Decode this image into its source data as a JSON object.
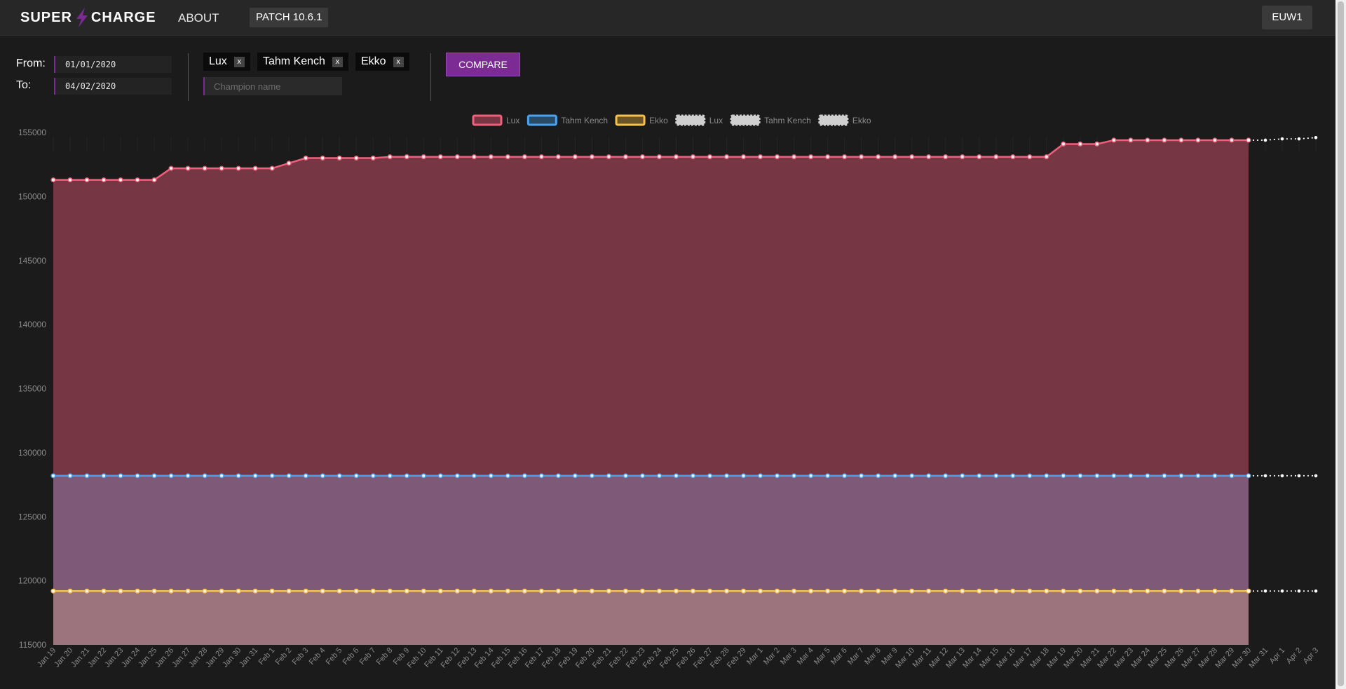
{
  "header": {
    "logo_left": "SUPER",
    "logo_right": "CHARGE",
    "about_label": "ABOUT",
    "patch_label": "PATCH 10.6.1",
    "region_label": "EUW1"
  },
  "colors": {
    "accent": "#7b2b93",
    "lux": "#f0607c",
    "tahm": "#4aa3f0",
    "ekko": "#f5c24e"
  },
  "icons": {
    "logo": "lightning-bolt-icon",
    "remove_champion": "close-x-icon"
  },
  "filters": {
    "from_label": "From:",
    "to_label": "To:",
    "from_value": "01/01/2020",
    "to_value": "04/02/2020",
    "champions": [
      {
        "name": "Lux",
        "remove": "x"
      },
      {
        "name": "Tahm Kench",
        "remove": "x"
      },
      {
        "name": "Ekko",
        "remove": "x"
      }
    ],
    "search_placeholder": "Champion name",
    "compare_label": "COMPARE"
  },
  "chart_data": {
    "type": "area",
    "x": [
      "Jan 19",
      "Jan 20",
      "Jan 21",
      "Jan 22",
      "Jan 23",
      "Jan 24",
      "Jan 25",
      "Jan 26",
      "Jan 27",
      "Jan 28",
      "Jan 29",
      "Jan 30",
      "Jan 31",
      "Feb 1",
      "Feb 2",
      "Feb 3",
      "Feb 4",
      "Feb 5",
      "Feb 6",
      "Feb 7",
      "Feb 8",
      "Feb 9",
      "Feb 10",
      "Feb 11",
      "Feb 12",
      "Feb 13",
      "Feb 14",
      "Feb 15",
      "Feb 16",
      "Feb 17",
      "Feb 18",
      "Feb 19",
      "Feb 20",
      "Feb 21",
      "Feb 22",
      "Feb 23",
      "Feb 24",
      "Feb 25",
      "Feb 26",
      "Feb 27",
      "Feb 28",
      "Feb 29",
      "Mar 1",
      "Mar 2",
      "Mar 3",
      "Mar 4",
      "Mar 5",
      "Mar 6",
      "Mar 7",
      "Mar 8",
      "Mar 9",
      "Mar 10",
      "Mar 11",
      "Mar 12",
      "Mar 13",
      "Mar 14",
      "Mar 15",
      "Mar 16",
      "Mar 17",
      "Mar 18",
      "Mar 19",
      "Mar 20",
      "Mar 21",
      "Mar 22",
      "Mar 23",
      "Mar 24",
      "Mar 25",
      "Mar 26",
      "Mar 27",
      "Mar 28",
      "Mar 29",
      "Mar 30",
      "Mar 31",
      "Apr 1",
      "Apr 2",
      "Apr 3"
    ],
    "ylim": [
      115000,
      155000
    ],
    "yticks": [
      155000,
      150000,
      145000,
      140000,
      135000,
      130000,
      125000,
      120000,
      115000
    ],
    "legend_position": "top-center",
    "grid": false,
    "series": [
      {
        "name": "Lux",
        "values": [
          151300,
          151300,
          151300,
          151300,
          151300,
          151300,
          151300,
          152200,
          152200,
          152200,
          152200,
          152200,
          152200,
          152200,
          152600,
          153000,
          153000,
          153000,
          153000,
          153000,
          153100,
          153100,
          153100,
          153100,
          153100,
          153100,
          153100,
          153100,
          153100,
          153100,
          153100,
          153100,
          153100,
          153100,
          153100,
          153100,
          153100,
          153100,
          153100,
          153100,
          153100,
          153100,
          153100,
          153100,
          153100,
          153100,
          153100,
          153100,
          153100,
          153100,
          153100,
          153100,
          153100,
          153100,
          153100,
          153100,
          153100,
          153100,
          153100,
          153100,
          154100,
          154100,
          154100,
          154400,
          154400,
          154400,
          154400,
          154400,
          154400,
          154400,
          154400,
          154400
        ]
      },
      {
        "name": "Tahm Kench",
        "values": [
          128200,
          128200,
          128200,
          128200,
          128200,
          128200,
          128200,
          128200,
          128200,
          128200,
          128200,
          128200,
          128200,
          128200,
          128200,
          128200,
          128200,
          128200,
          128200,
          128200,
          128200,
          128200,
          128200,
          128200,
          128200,
          128200,
          128200,
          128200,
          128200,
          128200,
          128200,
          128200,
          128200,
          128200,
          128200,
          128200,
          128200,
          128200,
          128200,
          128200,
          128200,
          128200,
          128200,
          128200,
          128200,
          128200,
          128200,
          128200,
          128200,
          128200,
          128200,
          128200,
          128200,
          128200,
          128200,
          128200,
          128200,
          128200,
          128200,
          128200,
          128200,
          128200,
          128200,
          128200,
          128200,
          128200,
          128200,
          128200,
          128200,
          128200,
          128200,
          128200
        ]
      },
      {
        "name": "Ekko",
        "values": [
          119200,
          119200,
          119200,
          119200,
          119200,
          119200,
          119200,
          119200,
          119200,
          119200,
          119200,
          119200,
          119200,
          119200,
          119200,
          119200,
          119200,
          119200,
          119200,
          119200,
          119200,
          119200,
          119200,
          119200,
          119200,
          119200,
          119200,
          119200,
          119200,
          119200,
          119200,
          119200,
          119200,
          119200,
          119200,
          119200,
          119200,
          119200,
          119200,
          119200,
          119200,
          119200,
          119200,
          119200,
          119200,
          119200,
          119200,
          119200,
          119200,
          119200,
          119200,
          119200,
          119200,
          119200,
          119200,
          119200,
          119200,
          119200,
          119200,
          119200,
          119200,
          119200,
          119200,
          119200,
          119200,
          119200,
          119200,
          119200,
          119200,
          119200,
          119200,
          119200
        ]
      },
      {
        "name": "Lux",
        "values": [
          154400,
          154400,
          154500,
          154500,
          154600
        ]
      },
      {
        "name": "Tahm Kench",
        "values": [
          128200,
          128200,
          128200,
          128200,
          128200
        ]
      },
      {
        "name": "Ekko",
        "values": [
          119200,
          119200,
          119200,
          119200,
          119200
        ]
      }
    ]
  }
}
